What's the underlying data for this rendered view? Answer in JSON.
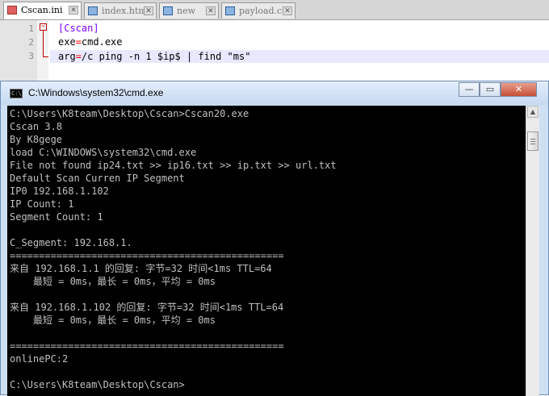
{
  "editor": {
    "tabs": [
      {
        "label": "Cscan.ini",
        "active": true
      },
      {
        "label": "index.htm",
        "active": false
      },
      {
        "label": "new",
        "active": false
      },
      {
        "label": "payload.c",
        "active": false
      }
    ],
    "line_numbers": [
      "1",
      "2",
      "3"
    ],
    "lines": {
      "l1": "[Cscan]",
      "l2_key": "exe",
      "l2_eq": "=",
      "l2_val": "cmd.exe",
      "l3_key": "arg",
      "l3_eq": "=",
      "l3_val": "/c ping -n 1 $ip$ | find \"ms\""
    },
    "fold_marker": "−",
    "tab_close_glyph": "✕"
  },
  "cmd_window": {
    "title": "C:\\Windows\\system32\\cmd.exe",
    "buttons": {
      "minimize": "—",
      "maximize": "▭",
      "close": "✕"
    },
    "scroll_up": "▲",
    "scroll_down": "▼",
    "lines": [
      "C:\\Users\\K8team\\Desktop\\Cscan>Cscan20.exe",
      "Cscan 3.8",
      "By K8gege",
      "load C:\\WINDOWS\\system32\\cmd.exe",
      "File not found ip24.txt >> ip16.txt >> ip.txt >> url.txt",
      "Default Scan Curren IP Segment",
      "IP0 192.168.1.102",
      "IP Count: 1",
      "Segment Count: 1",
      "",
      "C_Segment: 192.168.1.",
      "===============================================",
      "来自 192.168.1.1 的回复: 字节=32 时间<1ms TTL=64",
      "    最短 = 0ms，最长 = 0ms，平均 = 0ms",
      "",
      "来自 192.168.1.102 的回复: 字节=32 时间<1ms TTL=64",
      "    最短 = 0ms，最长 = 0ms，平均 = 0ms",
      "",
      "===============================================",
      "onlinePC:2",
      "",
      "C:\\Users\\K8team\\Desktop\\Cscan>"
    ]
  },
  "colors": {
    "console_bg": "#000000",
    "console_text": "#c0c0c0",
    "section_color": "#8000ff",
    "operator_color": "#ff0000"
  }
}
